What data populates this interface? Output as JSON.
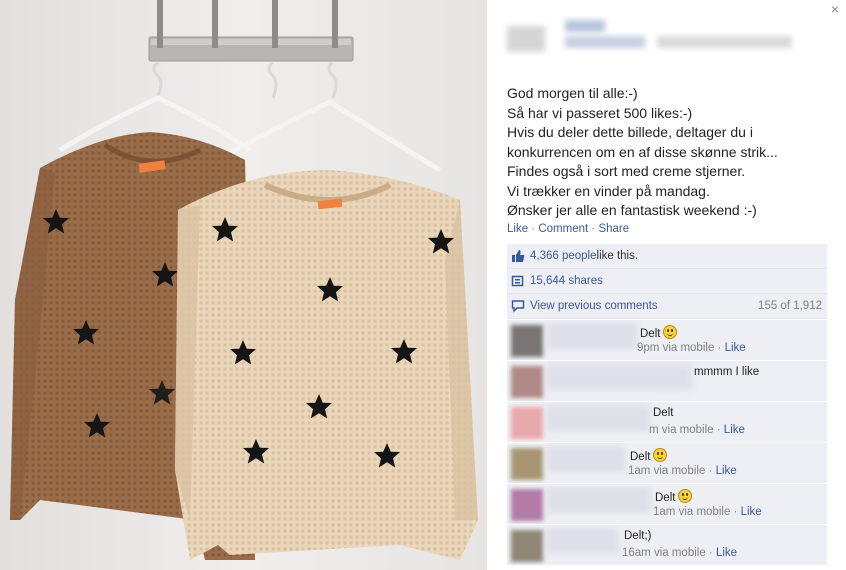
{
  "colors": {
    "link": "#3b5998",
    "ufi_background": "#edeff4",
    "sweater_left": "#9a6d4a",
    "sweater_right": "#ead6ba",
    "stars": "#151515",
    "label_tag": "#f08040"
  },
  "photo": {
    "subject": "two knit sweaters with black stars on hangers",
    "icon": "photo-icon"
  },
  "close_label": "×",
  "post": {
    "lines": [
      "God morgen til alle:-)",
      "Så har vi passeret 500 likes:-)",
      "Hvis du deler dette billede, deltager du i",
      "konkurrencen om en af disse skønne strik...",
      "Findes også i sort med creme stjerner.",
      "Vi trækker en vinder på mandag.",
      "Ønsker jer alle en fantastisk weekend :-)"
    ]
  },
  "actions": {
    "like": "Like",
    "comment": "Comment",
    "share": "Share",
    "separator": " · "
  },
  "ufi": {
    "likes_count": "4,366 people",
    "likes_suffix": " like this.",
    "shares": "15,644 shares",
    "view_previous": "View previous comments",
    "comment_count": "155 of 1,912"
  },
  "comments": [
    {
      "text": "Delt",
      "smiley": true,
      "meta": "9pm via mobile",
      "like": "Like",
      "avatar": "#7a7574"
    },
    {
      "text": "mmmm I like",
      "smiley": false,
      "meta": "",
      "like": "",
      "avatar": "#b08a86"
    },
    {
      "text": "Delt",
      "smiley": false,
      "meta": "m via mobile",
      "like": "Like",
      "avatar": "#e8a9ad"
    },
    {
      "text": "Delt",
      "smiley": true,
      "meta": "1am via mobile",
      "like": "Like",
      "avatar": "#a89572"
    },
    {
      "text": "Delt",
      "smiley": true,
      "meta": "1am via mobile",
      "like": "Like",
      "avatar": "#b27ba8"
    },
    {
      "text": "Delt;)",
      "smiley": false,
      "meta": "16am via mobile",
      "like": "Like",
      "avatar": "#8f8675"
    }
  ]
}
